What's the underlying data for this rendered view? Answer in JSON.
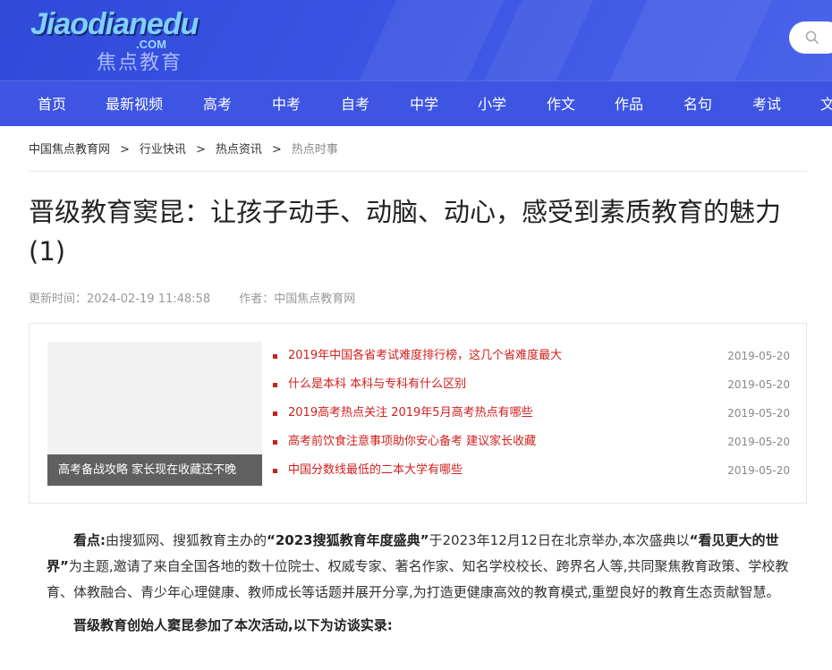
{
  "header": {
    "logo_main": "Jiaodianedu",
    "logo_com": ".COM",
    "logo_cn": "焦点教育",
    "search_icon": "search-icon"
  },
  "nav": {
    "items": [
      "首页",
      "最新视频",
      "高考",
      "中考",
      "自考",
      "中学",
      "小学",
      "作文",
      "作品",
      "名句",
      "考试",
      "文"
    ]
  },
  "breadcrumb": {
    "items": [
      "中国焦点教育网",
      "行业快讯",
      "热点资讯",
      "热点时事"
    ],
    "separator": ">"
  },
  "article": {
    "title": "晋级教育窦昆：让孩子动手、动脑、动心，感受到素质教育的魅力(1)",
    "updated_label": "更新时间：",
    "updated_value": "2024-02-19 11:48:58",
    "author_label": "作者：",
    "author_value": "中国焦点教育网",
    "lead_label": "看点:",
    "lead_part1": "由搜狐网、搜狐教育主办的",
    "lead_bold1": "“2023搜狐教育年度盛典”",
    "lead_part2": "于2023年12月12日在北京举办,本次盛典以",
    "lead_bold2": "“看见更大的世界”",
    "lead_part3": "为主题,邀请了来自全国各地的数十位院士、权威专家、著名作家、知名学校校长、跨界名人等,共同聚焦教育政策、学校教育、体教融合、青少年心理健康、教师成长等话题并展开分享,为打造更健康高效的教育模式,重塑良好的教育生态贡献智慧。",
    "interview_intro": "晋级教育创始人窦昆参加了本次活动,以下为访谈实录:"
  },
  "related": {
    "thumb_caption": "高考备战攻略 家长现在收藏还不晚",
    "items": [
      {
        "title": "2019年中国各省考试难度排行榜，这几个省难度最大",
        "date": "2019-05-20"
      },
      {
        "title": "什么是本科 本科与专科有什么区别",
        "date": "2019-05-20"
      },
      {
        "title": "2019高考热点关注 2019年5月高考热点有哪些",
        "date": "2019-05-20"
      },
      {
        "title": "高考前饮食注意事项助你安心备考 建议家长收藏",
        "date": "2019-05-20"
      },
      {
        "title": "中国分数线最低的二本大学有哪些",
        "date": "2019-05-20"
      }
    ]
  },
  "colors": {
    "header_blue": "#3a55e3",
    "link_red": "#d0201e",
    "meta_gray": "#999999"
  }
}
